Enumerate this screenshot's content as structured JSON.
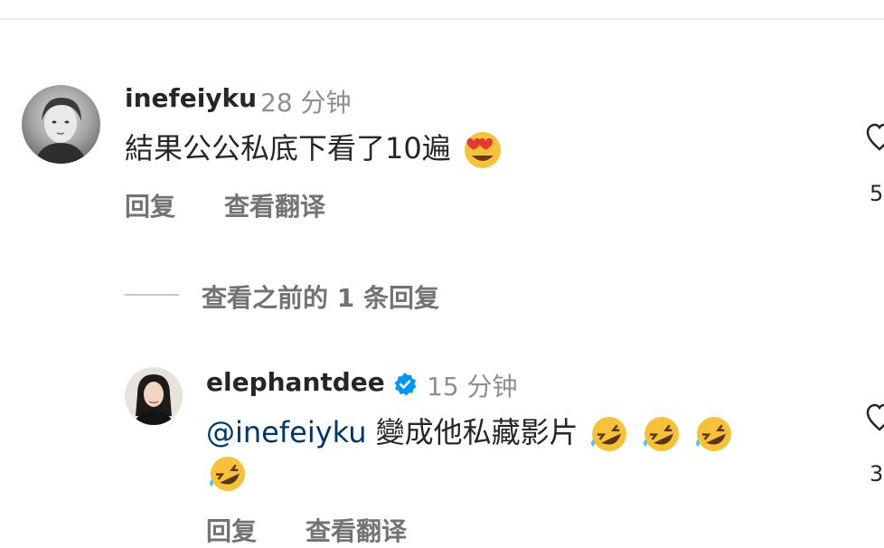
{
  "comments": [
    {
      "username": "inefeiyku",
      "time": "28 分钟",
      "text": "結果公公私底下看了10遍",
      "emoji": "smiling-face-with-heart-eyes",
      "reply_label": "回复",
      "translate_label": "查看翻译",
      "like_count": "5"
    }
  ],
  "view_previous_replies": "查看之前的 1 条回复",
  "replies": [
    {
      "username": "elephantdee",
      "verified": true,
      "time": "15 分钟",
      "mention": "@inefeiyku",
      "text": " 變成他私藏影片",
      "emoji": "rolling-on-the-floor-laughing",
      "emoji_count": 4,
      "reply_label": "回复",
      "translate_label": "查看翻译",
      "like_count": "3"
    }
  ],
  "colors": {
    "primary_text": "#262626",
    "secondary_text": "#8e8e8e",
    "action_text": "#737373",
    "mention": "#00376b",
    "verified_badge": "#0095f6"
  }
}
